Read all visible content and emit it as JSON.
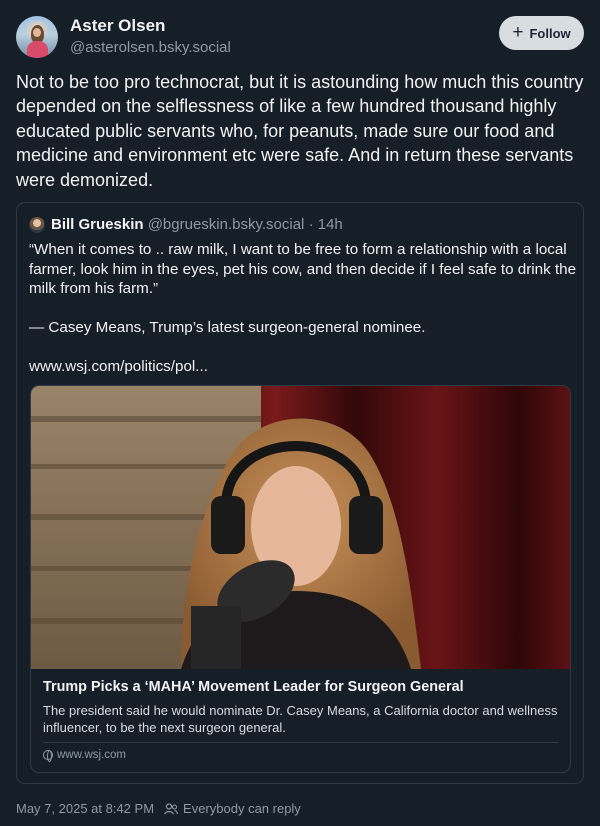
{
  "author": {
    "display_name": "Aster Olsen",
    "handle": "@asterolsen.bsky.social",
    "avatar_icon": "avatar-photo"
  },
  "follow_button": {
    "label": "Follow",
    "icon": "plus-icon"
  },
  "post": {
    "text": "Not to be too pro technocrat, but it is astounding how much this country depended on the selflessness of like a few hundred thousand highly educated public servants who, for peanuts, made sure our food and medicine and environment etc were safe. And in return these servants were demonized."
  },
  "quote": {
    "author_name": "Bill Grueskin",
    "author_handle": "@bgrueskin.bsky.social",
    "separator": "·",
    "time": "14h",
    "text": "“When it comes to .. raw milk, I want to be free to form a relationship with a local farmer, look him in the eyes, pet his cow, and then decide if I feel safe to drink the milk from his farm.”\n\n— Casey Means, Trump’s latest surgeon-general nominee.",
    "link": "www.wsj.com/politics/pol...",
    "embed": {
      "title": "Trump Picks a ‘MAHA’ Movement Leader for Surgeon General",
      "description": "The president said he would nominate Dr. Casey Means, a California doctor and wellness influencer, to be the next surgeon general.",
      "domain": "www.wsj.com",
      "image_description_icon": "podcast-photo"
    }
  },
  "footer": {
    "timestamp": "May 7, 2025 at 8:42 PM",
    "reply_setting": "Everybody can reply"
  },
  "colors": {
    "background": "#161e27",
    "text": "#f1f3f5",
    "muted": "#8d9aa8",
    "border": "#2e3a48",
    "follow_bg": "#d8dde2"
  }
}
